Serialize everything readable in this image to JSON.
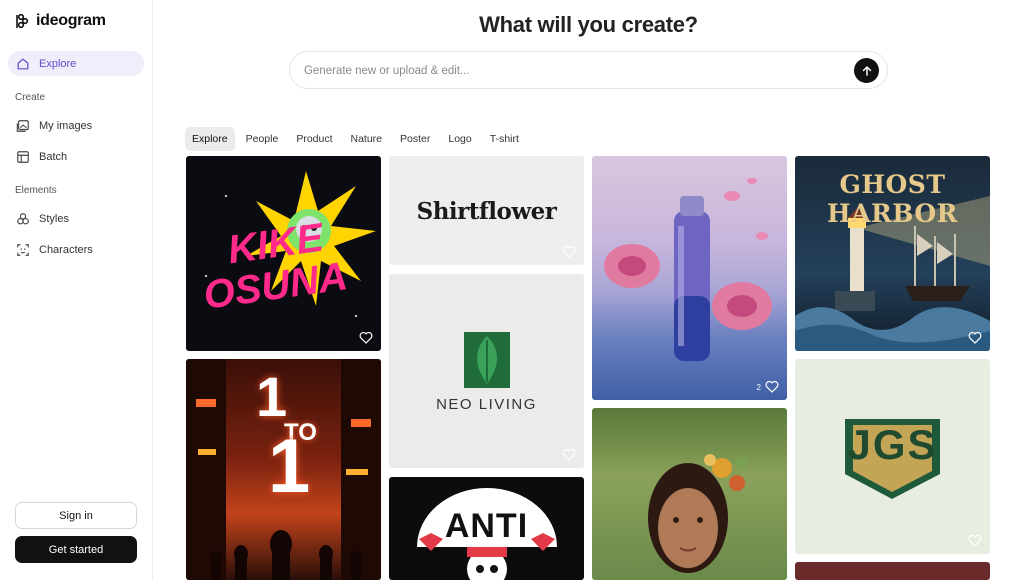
{
  "app": {
    "name": "ideogram"
  },
  "sidebar": {
    "explore": "Explore",
    "create_section": "Create",
    "my_images": "My images",
    "batch": "Batch",
    "elements_section": "Elements",
    "styles": "Styles",
    "characters": "Characters",
    "sign_in": "Sign in",
    "get_started": "Get started"
  },
  "main": {
    "headline": "What will you create?",
    "prompt_placeholder": "Generate new or upload & edit...",
    "tabs": [
      "Explore",
      "People",
      "Product",
      "Nature",
      "Poster",
      "Logo",
      "T-shirt"
    ]
  },
  "gallery": {
    "kike_osuna": {
      "line1": "KIKE",
      "line2": "OSUNA"
    },
    "one_to_one": {
      "big1": "1",
      "small": "TO",
      "big2": "1"
    },
    "shirtflower": {
      "text": "Shirtflower"
    },
    "neo_living": {
      "text": "NEO LIVING"
    },
    "anti": {
      "text": "ANTI"
    },
    "bottle_like_count": "2",
    "ghost_harbor": {
      "text": "GHOST HARBOR"
    },
    "jgs": {
      "text": "JGS"
    }
  },
  "colors": {
    "accent": "#5a4fc8",
    "active_nav_bg": "#f0eefb",
    "dark_button": "#111111"
  }
}
